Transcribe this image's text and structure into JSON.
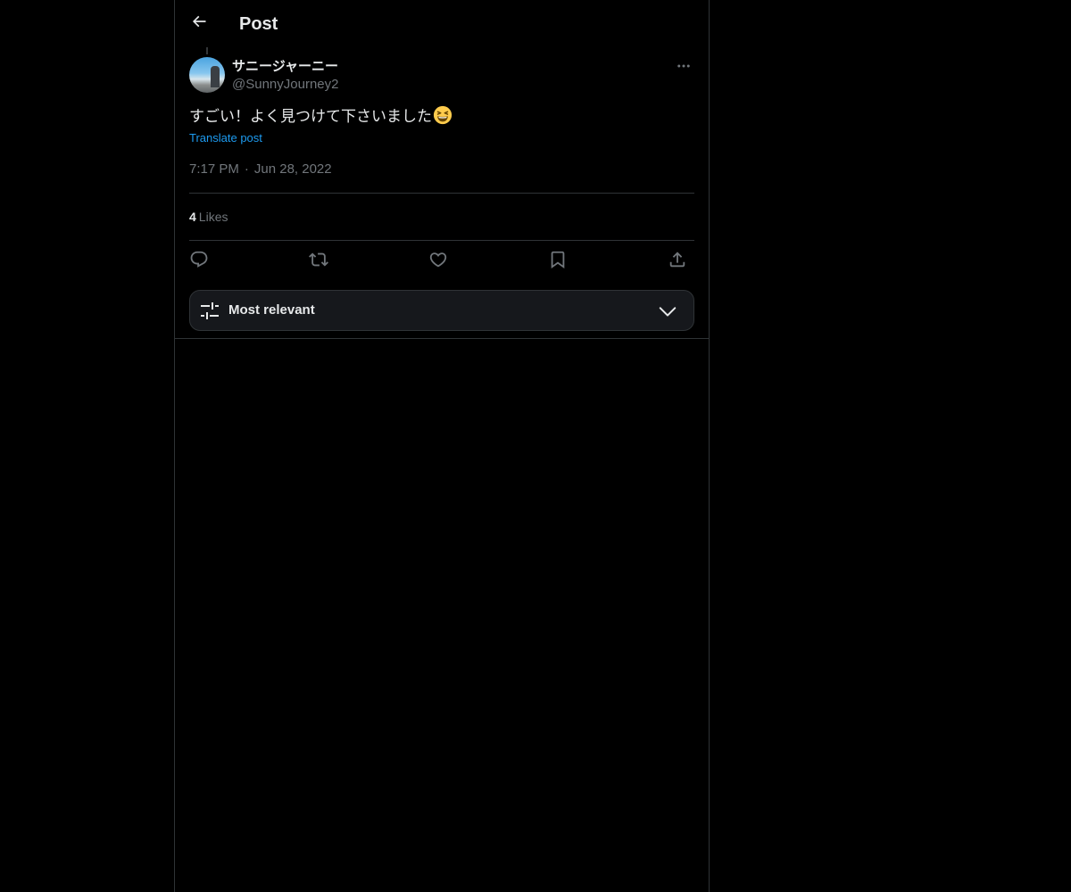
{
  "header": {
    "title": "Post"
  },
  "post": {
    "author_name": "サニージャーニー",
    "author_handle": "@SunnyJourney2",
    "text": "すごい！よく見つけて下さいました",
    "translate_label": "Translate post",
    "time": "7:17 PM",
    "date": "Jun 28, 2022",
    "separator": "·"
  },
  "stats": {
    "likes_count": "4",
    "likes_label": "Likes"
  },
  "actions": {
    "icons": [
      "reply-icon",
      "repost-icon",
      "like-icon",
      "bookmark-icon",
      "share-icon"
    ]
  },
  "sort": {
    "label": "Most relevant"
  },
  "colors": {
    "background": "#000000",
    "border": "#2f3336",
    "text_primary": "#e7e9ea",
    "text_secondary": "#71767b",
    "link": "#1d9bf0",
    "sort_bar_bg": "#16181c"
  }
}
